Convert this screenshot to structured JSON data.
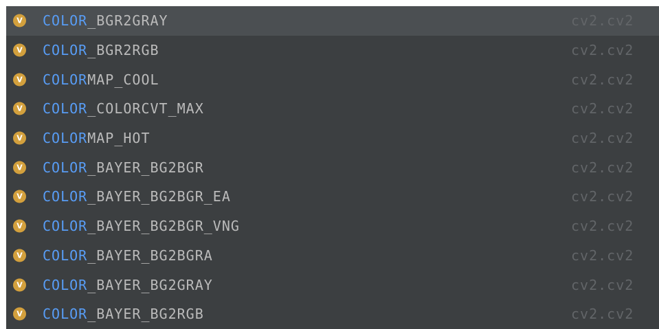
{
  "colors": {
    "popup_background": "#3c3f41",
    "selected_row": "#4b4f52",
    "match_highlight": "#589df6",
    "item_text": "#bbbbbb",
    "module_text": "#626568",
    "variable_icon": "#d3a03d"
  },
  "completion": {
    "kind_icon_letter": "V",
    "kind_icon_name": "variable-icon",
    "items": [
      {
        "match": "COLOR",
        "rest": "_BGR2GRAY",
        "module": "cv2.cv2",
        "selected": true
      },
      {
        "match": "COLOR",
        "rest": "_BGR2RGB",
        "module": "cv2.cv2",
        "selected": false
      },
      {
        "match": "COLOR",
        "rest": "MAP_COOL",
        "module": "cv2.cv2",
        "selected": false
      },
      {
        "match": "COLOR",
        "rest": "_COLORCVT_MAX",
        "module": "cv2.cv2",
        "selected": false
      },
      {
        "match": "COLOR",
        "rest": "MAP_HOT",
        "module": "cv2.cv2",
        "selected": false
      },
      {
        "match": "COLOR",
        "rest": "_BAYER_BG2BGR",
        "module": "cv2.cv2",
        "selected": false
      },
      {
        "match": "COLOR",
        "rest": "_BAYER_BG2BGR_EA",
        "module": "cv2.cv2",
        "selected": false
      },
      {
        "match": "COLOR",
        "rest": "_BAYER_BG2BGR_VNG",
        "module": "cv2.cv2",
        "selected": false
      },
      {
        "match": "COLOR",
        "rest": "_BAYER_BG2BGRA",
        "module": "cv2.cv2",
        "selected": false
      },
      {
        "match": "COLOR",
        "rest": "_BAYER_BG2GRAY",
        "module": "cv2.cv2",
        "selected": false
      },
      {
        "match": "COLOR",
        "rest": "_BAYER_BG2RGB",
        "module": "cv2.cv2",
        "selected": false
      }
    ]
  }
}
